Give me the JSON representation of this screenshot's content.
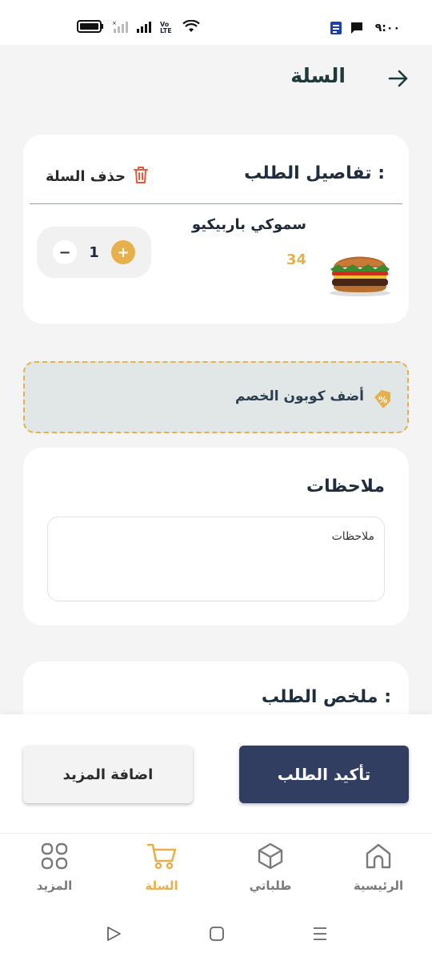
{
  "status_bar": {
    "time": "٩:٠٠",
    "volte": "Vo LTE"
  },
  "header": {
    "title": "السلة"
  },
  "order": {
    "title": "تفاصيل الطلب :",
    "delete_label": "حذف السلة",
    "item": {
      "name": "سموكي باربيكيو",
      "price": "34",
      "quantity": "1"
    }
  },
  "coupon": {
    "label": "أضف كوبون الخصم"
  },
  "notes": {
    "title": "ملاحظات",
    "placeholder": "ملاحظات"
  },
  "summary": {
    "title": "ملخص الطلب :"
  },
  "actions": {
    "confirm_label": "تأكيد الطلب",
    "add_more_label": "اضافة المزيد"
  },
  "nav": [
    {
      "label": "الرئيسية",
      "icon": "home-icon"
    },
    {
      "label": "طلباتي",
      "icon": "box-icon"
    },
    {
      "label": "السلة",
      "icon": "cart-icon",
      "active": true
    },
    {
      "label": "المزيد",
      "icon": "grid-icon"
    }
  ],
  "colors": {
    "accent": "#e8b04a",
    "primary": "#323d62",
    "coupon_bg": "#e1e7e7",
    "danger": "#e25b3c"
  }
}
